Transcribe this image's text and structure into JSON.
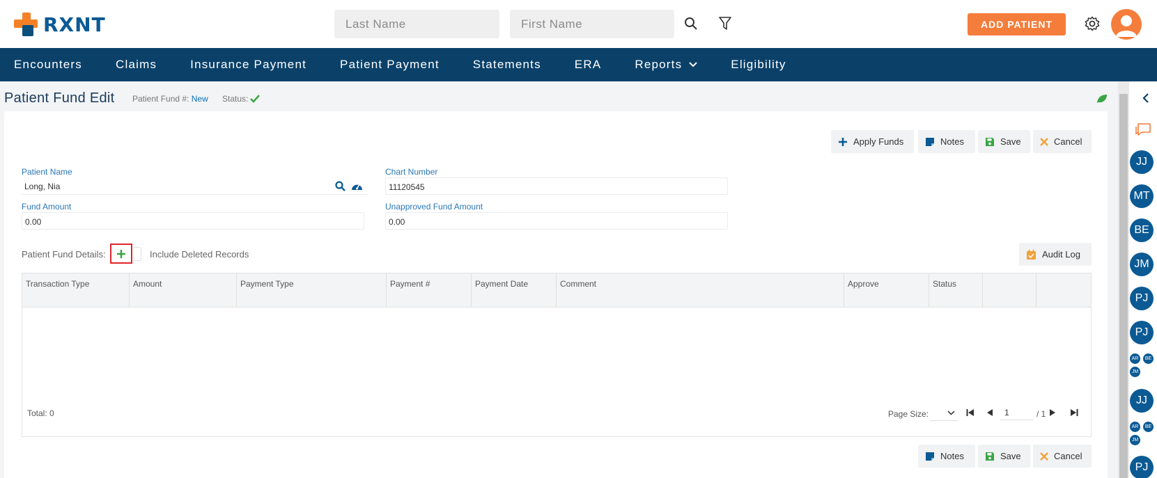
{
  "brand": {
    "name": "RXNT"
  },
  "search": {
    "last_placeholder": "Last Name",
    "first_placeholder": "First Name"
  },
  "header": {
    "add_patient": "ADD PATIENT"
  },
  "nav": {
    "items": [
      "Encounters",
      "Claims",
      "Insurance Payment",
      "Patient Payment",
      "Statements",
      "ERA",
      "Reports",
      "Eligibility"
    ]
  },
  "page": {
    "title": "Patient Fund Edit",
    "fund_no_label": "Patient Fund #:",
    "fund_no_value": "New",
    "status_label": "Status:"
  },
  "actions": {
    "apply_funds": "Apply Funds",
    "notes": "Notes",
    "save": "Save",
    "cancel": "Cancel",
    "audit_log": "Audit Log"
  },
  "form": {
    "patient_name_label": "Patient Name",
    "patient_name_value": "Long, Nia",
    "chart_number_label": "Chart Number",
    "chart_number_value": "11120545",
    "fund_amount_label": "Fund Amount",
    "fund_amount_value": "0.00",
    "unapproved_label": "Unapproved Fund Amount",
    "unapproved_value": "0.00"
  },
  "details": {
    "label": "Patient Fund Details:",
    "include_deleted": "Include Deleted Records"
  },
  "grid": {
    "columns": [
      "Transaction Type",
      "Amount",
      "Payment Type",
      "Payment #",
      "Payment Date",
      "Comment",
      "Approve",
      "Status",
      "",
      ""
    ],
    "total": "Total: 0",
    "page_size_label": "Page Size:",
    "page_value": "1",
    "page_total": "/ 1"
  },
  "rail": {
    "chips": [
      "JJ",
      "MT",
      "BE",
      "JM",
      "PJ",
      "PJ",
      "JJ",
      "PJ"
    ],
    "mini_groups": [
      [
        "AR",
        "BE",
        "JM"
      ],
      [
        "AR",
        "BE",
        "JM"
      ]
    ]
  },
  "colors": {
    "primary": "#0b4169",
    "accent": "#f57d3b",
    "link": "#2a77b5",
    "success": "#3aa545"
  }
}
